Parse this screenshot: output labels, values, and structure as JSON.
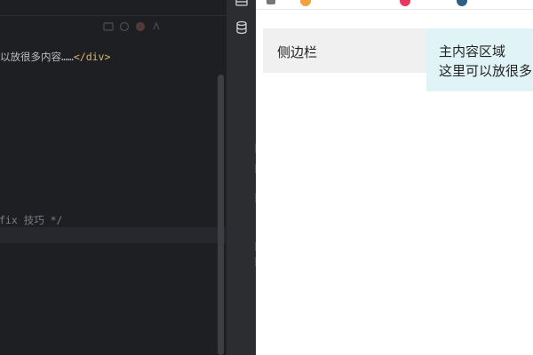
{
  "editor": {
    "code_text_line": "以放很多内容……",
    "code_close_tag": "</div>",
    "comment_line": "fix 技巧 */",
    "inspection_icons": [
      "warning-icon",
      "error-icon",
      "chrome-icon",
      "ai-icon"
    ]
  },
  "tool_strip": {
    "icons": [
      "notifications-icon",
      "database-icon"
    ]
  },
  "preview": {
    "sidebar_label": "侧边栏",
    "main_title": "主内容区域",
    "main_text": "这里可以放很多内容"
  },
  "colors": {
    "editor_bg": "#1e1f22",
    "tag_color": "#d5b778",
    "comment_color": "#7a7e85",
    "sidebar_bg": "#f0f0f0",
    "main_bg": "#e0f4f7"
  }
}
